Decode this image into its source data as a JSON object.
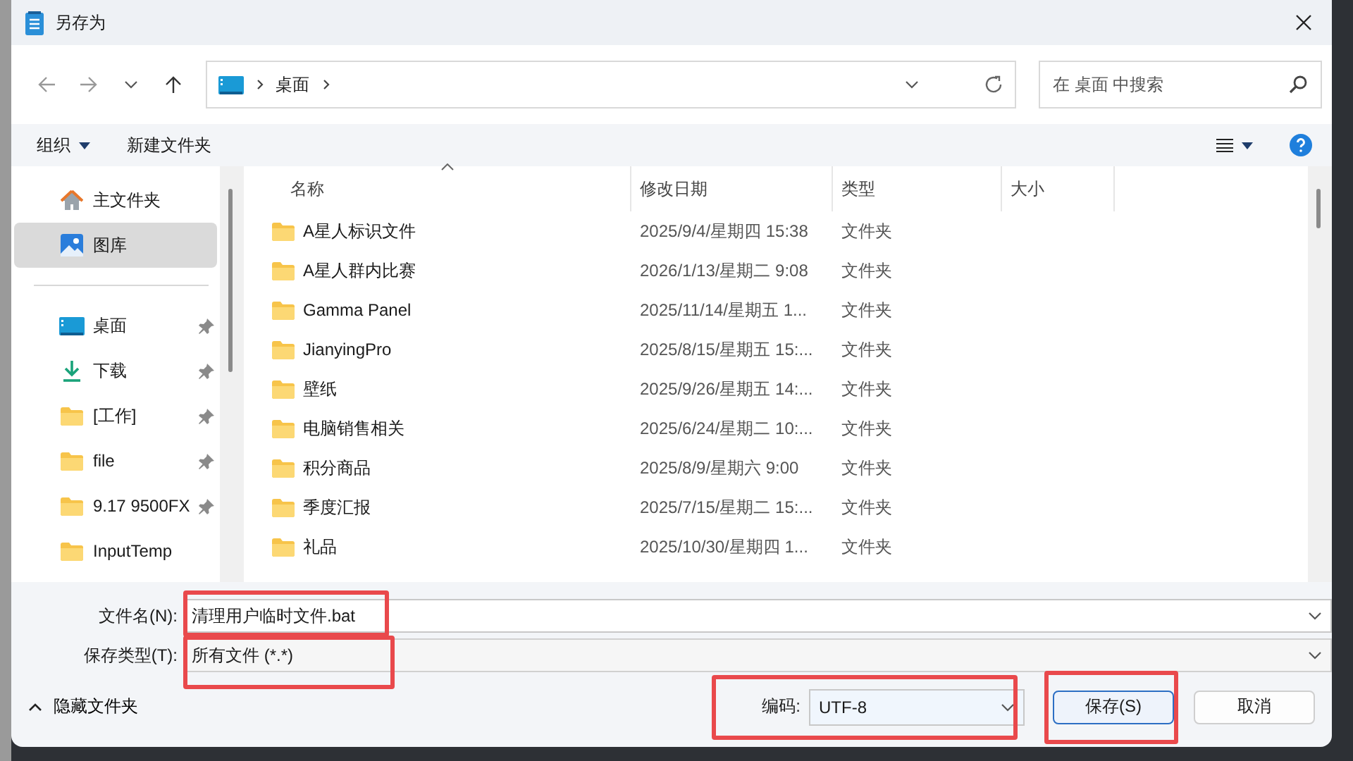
{
  "window": {
    "title": "另存为"
  },
  "address": {
    "path": [
      "桌面"
    ]
  },
  "search": {
    "placeholder": "在 桌面 中搜索"
  },
  "toolbar": {
    "organize": "组织",
    "new_folder": "新建文件夹"
  },
  "sidebar": {
    "groups": [
      [
        {
          "label": "主文件夹",
          "kind": "home",
          "selected": false,
          "pinned": false
        },
        {
          "label": "图库",
          "kind": "gallery",
          "selected": true,
          "pinned": false
        }
      ],
      [
        {
          "label": "桌面",
          "kind": "desktop",
          "selected": false,
          "pinned": true
        },
        {
          "label": "下载",
          "kind": "download",
          "selected": false,
          "pinned": true
        },
        {
          "label": "[工作]",
          "kind": "folder",
          "selected": false,
          "pinned": true
        },
        {
          "label": "file",
          "kind": "folder",
          "selected": false,
          "pinned": true
        },
        {
          "label": "9.17 9500FX",
          "kind": "folder",
          "selected": false,
          "pinned": true
        },
        {
          "label": "InputTemp",
          "kind": "folder",
          "selected": false,
          "pinned": false
        }
      ]
    ]
  },
  "table": {
    "columns": [
      {
        "label": "名称",
        "sorted": true
      },
      {
        "label": "修改日期",
        "sorted": false
      },
      {
        "label": "类型",
        "sorted": false
      },
      {
        "label": "大小",
        "sorted": false
      }
    ],
    "rows": [
      {
        "name": "A星人标识文件",
        "modified": "2025/9/4/星期四 15:38",
        "type": "文件夹"
      },
      {
        "name": "A星人群内比赛",
        "modified": "2026/1/13/星期二 9:08",
        "type": "文件夹"
      },
      {
        "name": "Gamma Panel",
        "modified": "2025/11/14/星期五 1...",
        "type": "文件夹"
      },
      {
        "name": "JianyingPro",
        "modified": "2025/8/15/星期五 15:...",
        "type": "文件夹"
      },
      {
        "name": "壁纸",
        "modified": "2025/9/26/星期五 14:...",
        "type": "文件夹"
      },
      {
        "name": "电脑销售相关",
        "modified": "2025/6/24/星期二 10:...",
        "type": "文件夹"
      },
      {
        "name": "积分商品",
        "modified": "2025/8/9/星期六 9:00",
        "type": "文件夹"
      },
      {
        "name": "季度汇报",
        "modified": "2025/7/15/星期二 15:...",
        "type": "文件夹"
      },
      {
        "name": "礼品",
        "modified": "2025/10/30/星期四 1...",
        "type": "文件夹"
      }
    ]
  },
  "form": {
    "filename": {
      "label": "文件名(N):",
      "value": "清理用户临时文件.bat",
      "highlighted": true
    },
    "filetype": {
      "label": "保存类型(T):",
      "value": "所有文件 (*.*)",
      "highlighted": true
    }
  },
  "footer": {
    "hide_folders": "隐藏文件夹",
    "encoding": {
      "label": "编码:",
      "value": "UTF-8",
      "highlighted": true
    },
    "buttons": [
      {
        "label": "保存(S)",
        "kind": "primary",
        "highlighted": true
      },
      {
        "label": "取消",
        "kind": "secondary",
        "highlighted": false
      }
    ]
  }
}
